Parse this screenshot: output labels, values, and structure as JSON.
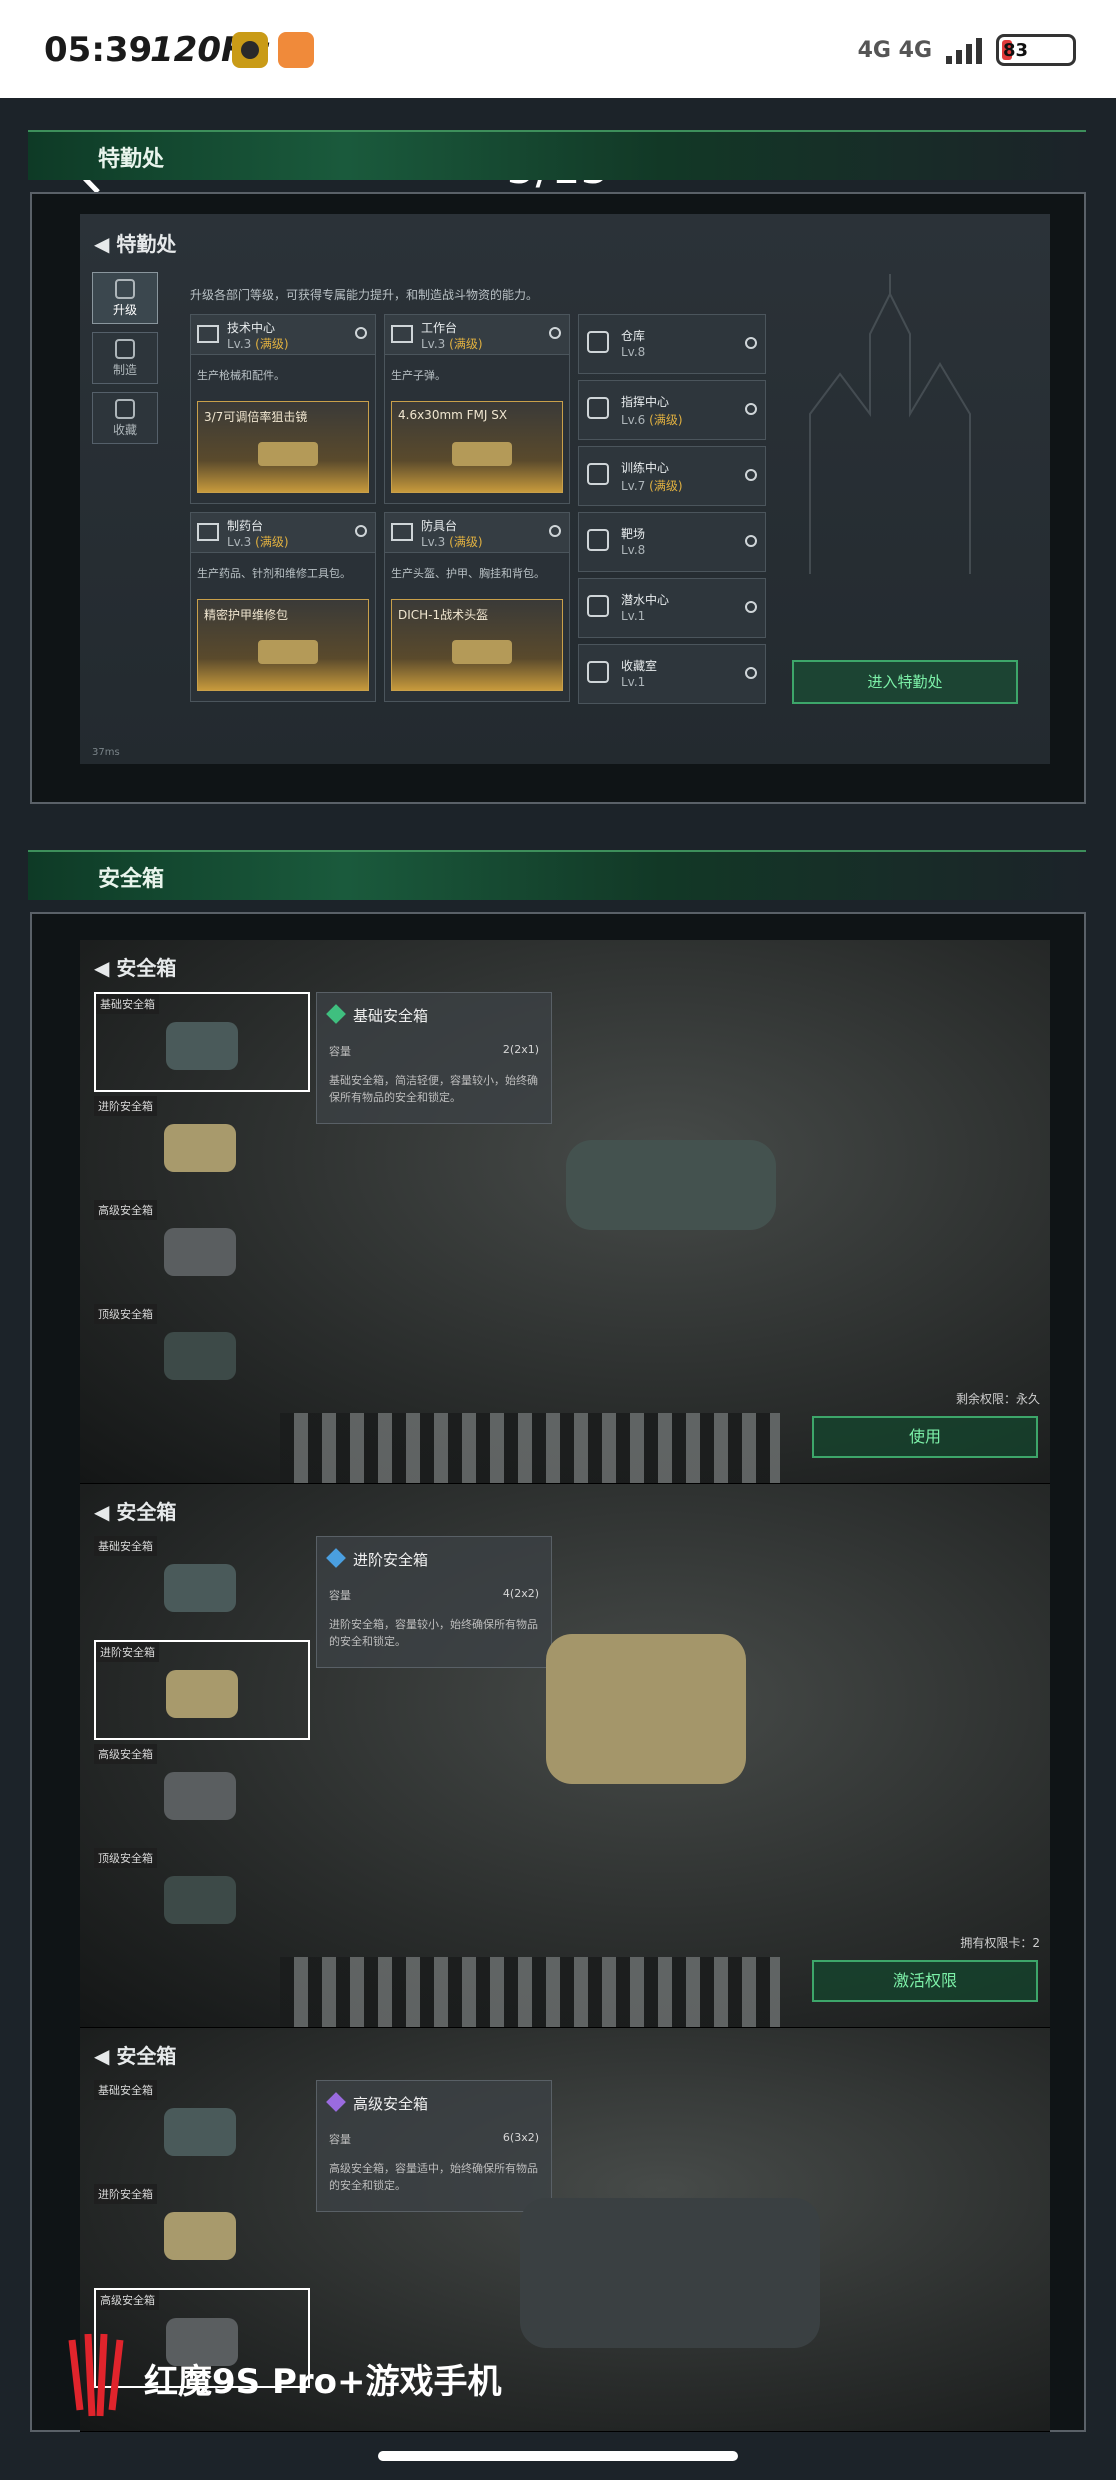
{
  "status_bar": {
    "time": "05:39",
    "refresh": "120Hz",
    "network": "4G 4G",
    "battery": "83"
  },
  "viewer": {
    "page_counter": "5/15"
  },
  "sections": [
    {
      "title": "特勤处"
    },
    {
      "title": "安全箱"
    }
  ],
  "special_ops": {
    "title": "特勤处",
    "description": "升级各部门等级，可获得专属能力提升，和制造战斗物资的能力。",
    "side_tabs": [
      {
        "label": "升级"
      },
      {
        "label": "制造"
      },
      {
        "label": "收藏"
      }
    ],
    "cards": [
      {
        "name": "技术中心",
        "level": "Lv.3",
        "status": "(满级)",
        "desc": "生产枪械和配件。",
        "product": "3/7可调倍率狙击镜"
      },
      {
        "name": "工作台",
        "level": "Lv.3",
        "status": "(满级)",
        "desc": "生产子弹。",
        "product": "4.6x30mm FMJ SX"
      },
      {
        "name": "制药台",
        "level": "Lv.3",
        "status": "(满级)",
        "desc": "生产药品、针剂和维修工具包。",
        "product": "精密护甲维修包"
      },
      {
        "name": "防具台",
        "level": "Lv.3",
        "status": "(满级)",
        "desc": "生产头盔、护甲、胸挂和背包。",
        "product": "DICH-1战术头盔"
      }
    ],
    "facilities": [
      {
        "name": "仓库",
        "level": "Lv.8",
        "status": ""
      },
      {
        "name": "指挥中心",
        "level": "Lv.6",
        "status": "(满级)"
      },
      {
        "name": "训练中心",
        "level": "Lv.7",
        "status": "(满级)"
      },
      {
        "name": "靶场",
        "level": "Lv.8",
        "status": ""
      },
      {
        "name": "潜水中心",
        "level": "Lv.1",
        "status": ""
      },
      {
        "name": "收藏室",
        "level": "Lv.1",
        "status": ""
      }
    ],
    "enter_button": "进入特勤处",
    "ping": "37ms"
  },
  "safebox": {
    "slot_labels": [
      "基础安全箱",
      "进阶安全箱",
      "高级安全箱",
      "顶级安全箱"
    ],
    "capacity_label": "容量",
    "panels": [
      {
        "title": "安全箱",
        "name": "基础安全箱",
        "capacity": "2(2x1)",
        "desc": "基础安全箱，简洁轻便，容量较小，始终确保所有物品的安全和锁定。",
        "permission": "剩余权限：永久",
        "button": "使用",
        "diamond_color": "#3fbf7f",
        "case_color": "#4a5a5a"
      },
      {
        "title": "安全箱",
        "name": "进阶安全箱",
        "capacity": "4(2x2)",
        "desc": "进阶安全箱，容量较小，始终确保所有物品的安全和锁定。",
        "permission": "拥有权限卡：2",
        "button": "激活权限",
        "diamond_color": "#4a9fe0",
        "case_color": "#a89a6c"
      },
      {
        "title": "安全箱",
        "name": "高级安全箱",
        "capacity": "6(3x2)",
        "desc": "高级安全箱，容量适中，始终确保所有物品的安全和锁定。",
        "diamond_color": "#9a6be0",
        "case_color": "#3c4244"
      }
    ]
  },
  "watermark": {
    "text": "红魔9S Pro+游戏手机"
  }
}
